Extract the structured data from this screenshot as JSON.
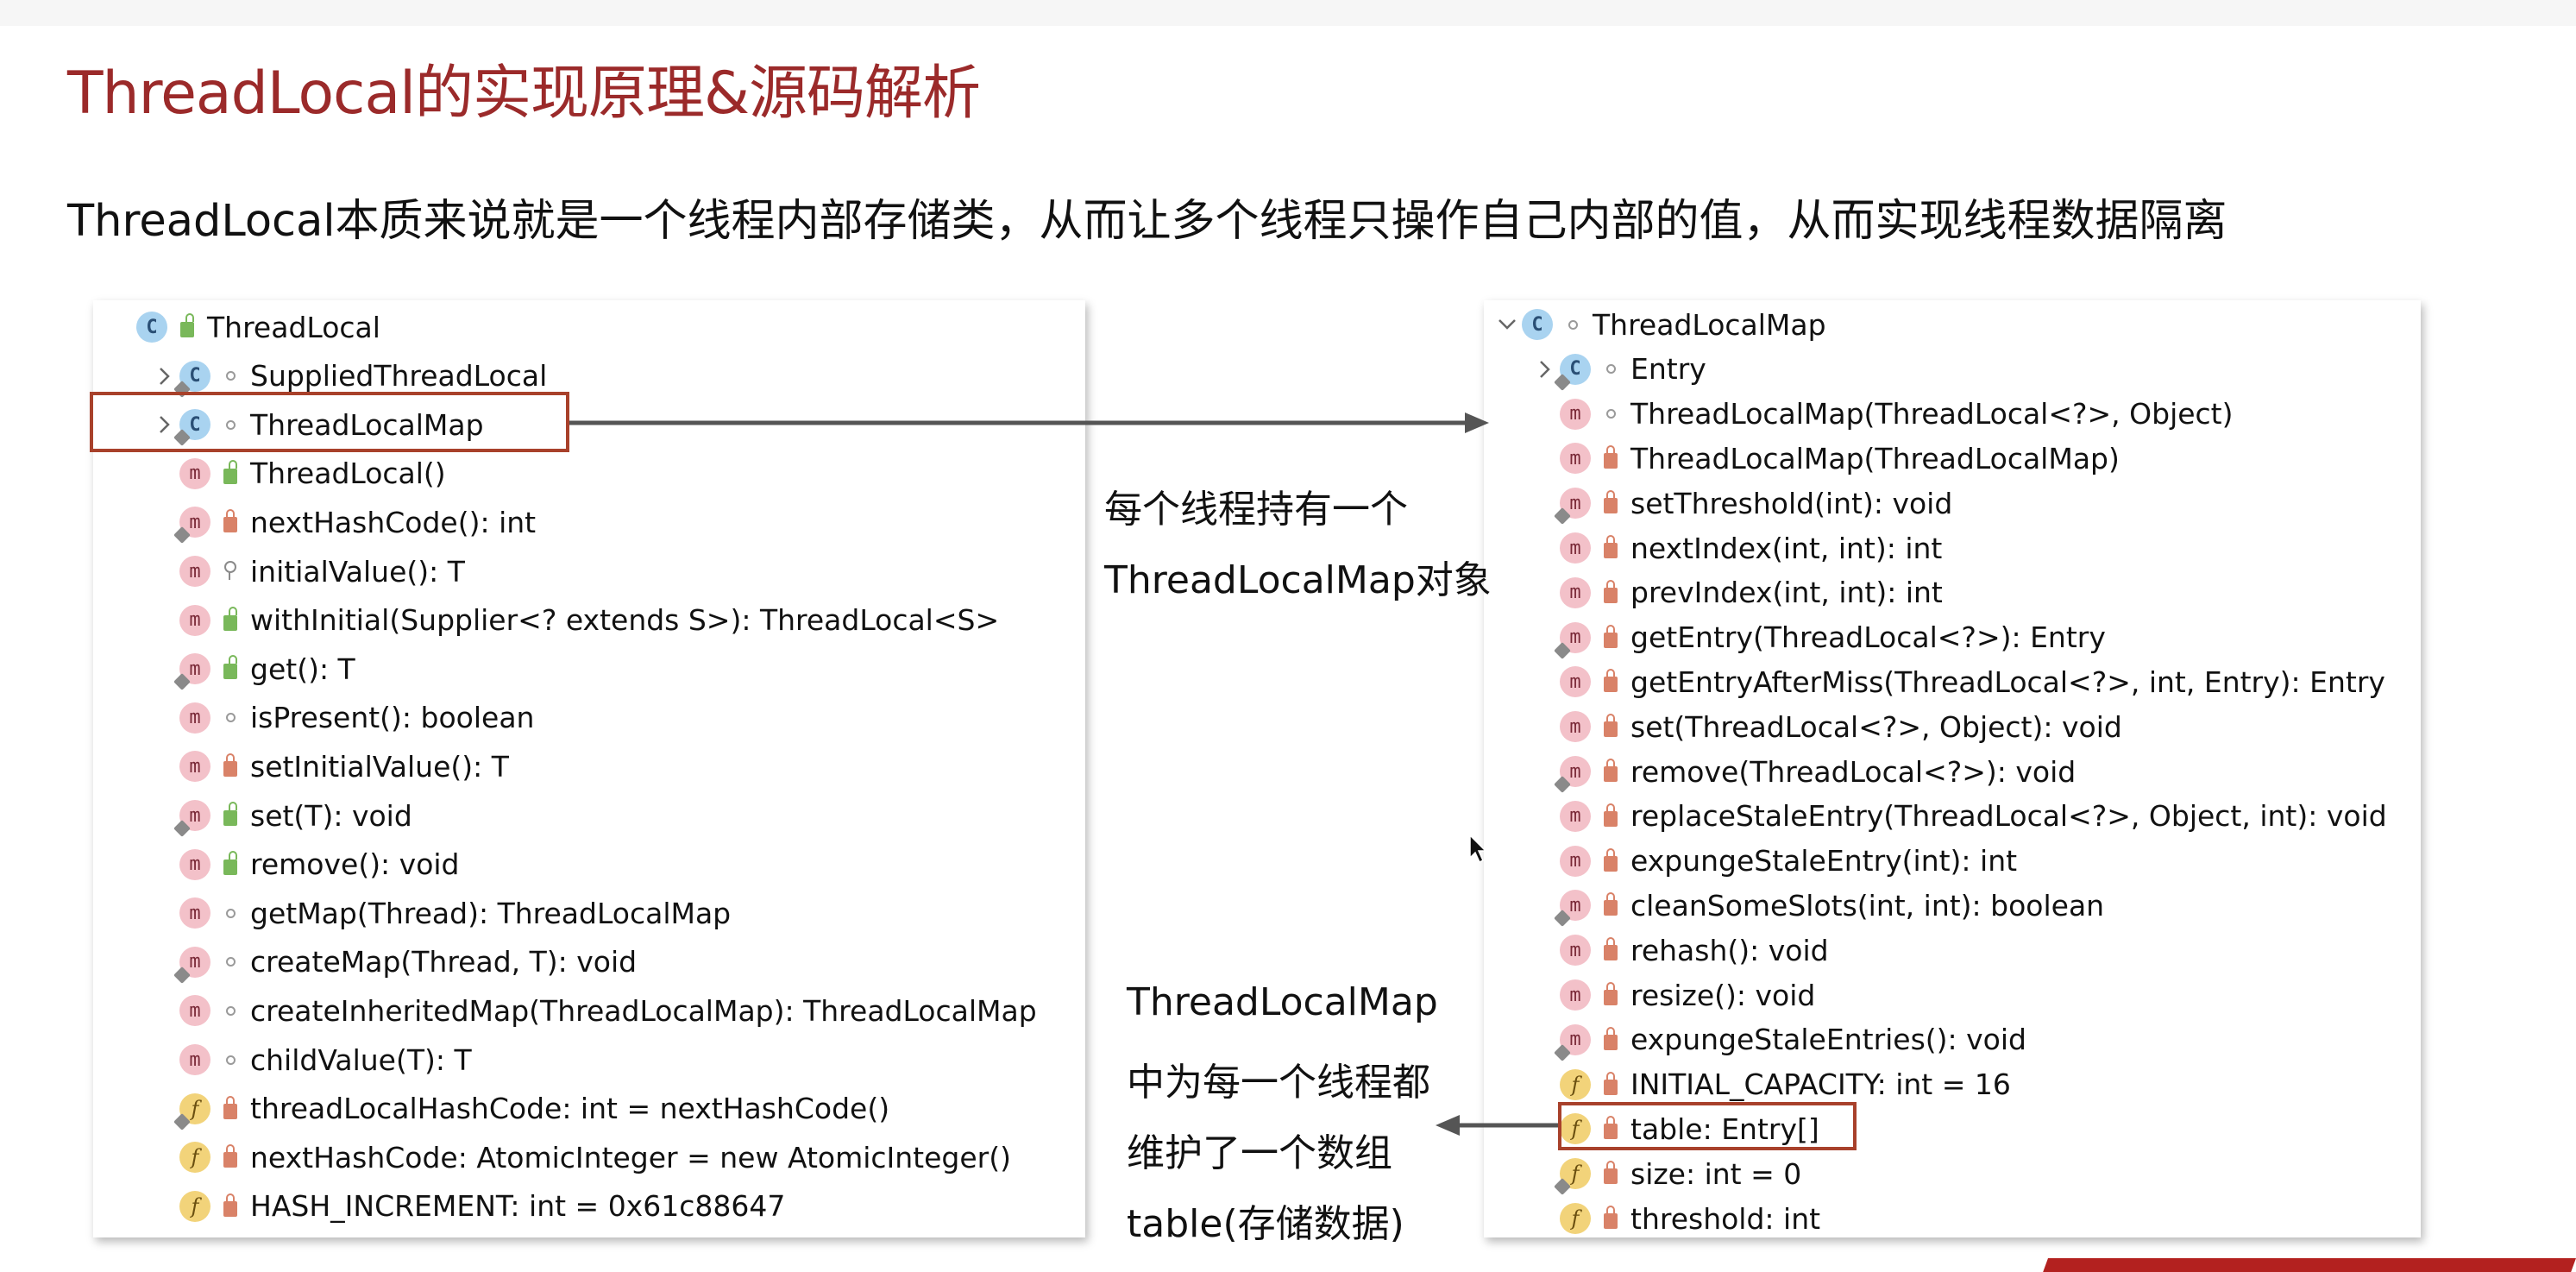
{
  "title": "ThreadLocal的实现原理&源码解析",
  "subtitle": "ThreadLocal本质来说就是一个线程内部存储类，从而让多个线程只操作自己内部的值，从而实现线程数据隔离",
  "left_panel": {
    "rows": [
      {
        "label": "ThreadLocal",
        "icon": "class-icon",
        "modifier": "public",
        "expander": "none",
        "indent": 0
      },
      {
        "label": "SuppliedThreadLocal",
        "icon": "class-icon",
        "modifier": "package",
        "expander": "collapsed",
        "indent": 1
      },
      {
        "label": "ThreadLocalMap",
        "icon": "class-icon",
        "modifier": "package",
        "expander": "collapsed",
        "indent": 1
      },
      {
        "label": "ThreadLocal()",
        "icon": "method-icon",
        "modifier": "public",
        "expander": "none",
        "indent": 1
      },
      {
        "label": "nextHashCode(): int",
        "icon": "method-icon",
        "modifier": "private",
        "expander": "none",
        "indent": 1
      },
      {
        "label": "initialValue(): T",
        "icon": "method-icon",
        "modifier": "protected",
        "expander": "none",
        "indent": 1
      },
      {
        "label": "withInitial(Supplier<? extends S>): ThreadLocal<S>",
        "icon": "method-icon",
        "modifier": "public",
        "expander": "none",
        "indent": 1
      },
      {
        "label": "get(): T",
        "icon": "method-icon",
        "modifier": "public",
        "expander": "none",
        "indent": 1
      },
      {
        "label": "isPresent(): boolean",
        "icon": "method-icon",
        "modifier": "package",
        "expander": "none",
        "indent": 1
      },
      {
        "label": "setInitialValue(): T",
        "icon": "method-icon",
        "modifier": "private",
        "expander": "none",
        "indent": 1
      },
      {
        "label": "set(T): void",
        "icon": "method-icon",
        "modifier": "public",
        "expander": "none",
        "indent": 1
      },
      {
        "label": "remove(): void",
        "icon": "method-icon",
        "modifier": "public",
        "expander": "none",
        "indent": 1
      },
      {
        "label": "getMap(Thread): ThreadLocalMap",
        "icon": "method-icon",
        "modifier": "package",
        "expander": "none",
        "indent": 1
      },
      {
        "label": "createMap(Thread, T): void",
        "icon": "method-icon",
        "modifier": "package",
        "expander": "none",
        "indent": 1
      },
      {
        "label": "createInheritedMap(ThreadLocalMap): ThreadLocalMap",
        "icon": "method-icon",
        "modifier": "package",
        "expander": "none",
        "indent": 1
      },
      {
        "label": "childValue(T): T",
        "icon": "method-icon",
        "modifier": "package",
        "expander": "none",
        "indent": 1
      },
      {
        "label": "threadLocalHashCode: int = nextHashCode()",
        "icon": "field-icon",
        "modifier": "private",
        "expander": "none",
        "indent": 1
      },
      {
        "label": "nextHashCode: AtomicInteger = new AtomicInteger()",
        "icon": "field-icon",
        "modifier": "private",
        "expander": "none",
        "indent": 1
      },
      {
        "label": "HASH_INCREMENT: int = 0x61c88647",
        "icon": "field-icon",
        "modifier": "private",
        "expander": "none",
        "indent": 1
      }
    ]
  },
  "right_panel": {
    "rows": [
      {
        "label": "ThreadLocalMap",
        "icon": "class-icon",
        "modifier": "package",
        "expander": "expanded",
        "indent": 0
      },
      {
        "label": "Entry",
        "icon": "class-icon",
        "modifier": "package",
        "expander": "collapsed",
        "indent": 1
      },
      {
        "label": "ThreadLocalMap(ThreadLocal<?>, Object)",
        "icon": "method-icon",
        "modifier": "package",
        "expander": "none",
        "indent": 1
      },
      {
        "label": "ThreadLocalMap(ThreadLocalMap)",
        "icon": "method-icon",
        "modifier": "private",
        "expander": "none",
        "indent": 1
      },
      {
        "label": "setThreshold(int): void",
        "icon": "method-icon",
        "modifier": "private",
        "expander": "none",
        "indent": 1
      },
      {
        "label": "nextIndex(int, int): int",
        "icon": "method-icon",
        "modifier": "private",
        "expander": "none",
        "indent": 1
      },
      {
        "label": "prevIndex(int, int): int",
        "icon": "method-icon",
        "modifier": "private",
        "expander": "none",
        "indent": 1
      },
      {
        "label": "getEntry(ThreadLocal<?>): Entry",
        "icon": "method-icon",
        "modifier": "private",
        "expander": "none",
        "indent": 1
      },
      {
        "label": "getEntryAfterMiss(ThreadLocal<?>, int, Entry): Entry",
        "icon": "method-icon",
        "modifier": "private",
        "expander": "none",
        "indent": 1
      },
      {
        "label": "set(ThreadLocal<?>, Object): void",
        "icon": "method-icon",
        "modifier": "private",
        "expander": "none",
        "indent": 1
      },
      {
        "label": "remove(ThreadLocal<?>): void",
        "icon": "method-icon",
        "modifier": "private",
        "expander": "none",
        "indent": 1
      },
      {
        "label": "replaceStaleEntry(ThreadLocal<?>, Object, int): void",
        "icon": "method-icon",
        "modifier": "private",
        "expander": "none",
        "indent": 1
      },
      {
        "label": "expungeStaleEntry(int): int",
        "icon": "method-icon",
        "modifier": "private",
        "expander": "none",
        "indent": 1
      },
      {
        "label": "cleanSomeSlots(int, int): boolean",
        "icon": "method-icon",
        "modifier": "private",
        "expander": "none",
        "indent": 1
      },
      {
        "label": "rehash(): void",
        "icon": "method-icon",
        "modifier": "private",
        "expander": "none",
        "indent": 1
      },
      {
        "label": "resize(): void",
        "icon": "method-icon",
        "modifier": "private",
        "expander": "none",
        "indent": 1
      },
      {
        "label": "expungeStaleEntries(): void",
        "icon": "method-icon",
        "modifier": "private",
        "expander": "none",
        "indent": 1
      },
      {
        "label": "INITIAL_CAPACITY: int = 16",
        "icon": "field-icon",
        "modifier": "private",
        "expander": "none",
        "indent": 1
      },
      {
        "label": "table: Entry[]",
        "icon": "field-icon",
        "modifier": "private",
        "expander": "none",
        "indent": 1
      },
      {
        "label": "size: int = 0",
        "icon": "field-icon",
        "modifier": "private",
        "expander": "none",
        "indent": 1
      },
      {
        "label": "threshold: int",
        "icon": "field-icon",
        "modifier": "private",
        "expander": "none",
        "indent": 1
      }
    ]
  },
  "annotations": {
    "top_line1": "每个线程持有一个",
    "top_line2": "ThreadLocalMap对象",
    "bottom_line1": "ThreadLocalMap",
    "bottom_line2": "中为每一个线程都",
    "bottom_line3": "维护了一个数组",
    "bottom_line4": "table(存储数据)"
  },
  "colors": {
    "title": "#9b2a2a",
    "highlight_box": "#a8412b",
    "arrow": "#555555",
    "method_badge": "#f3c1c9",
    "class_badge": "#a9d3f0",
    "field_badge": "#f2d37a",
    "footer_strip": "#b3211f"
  }
}
